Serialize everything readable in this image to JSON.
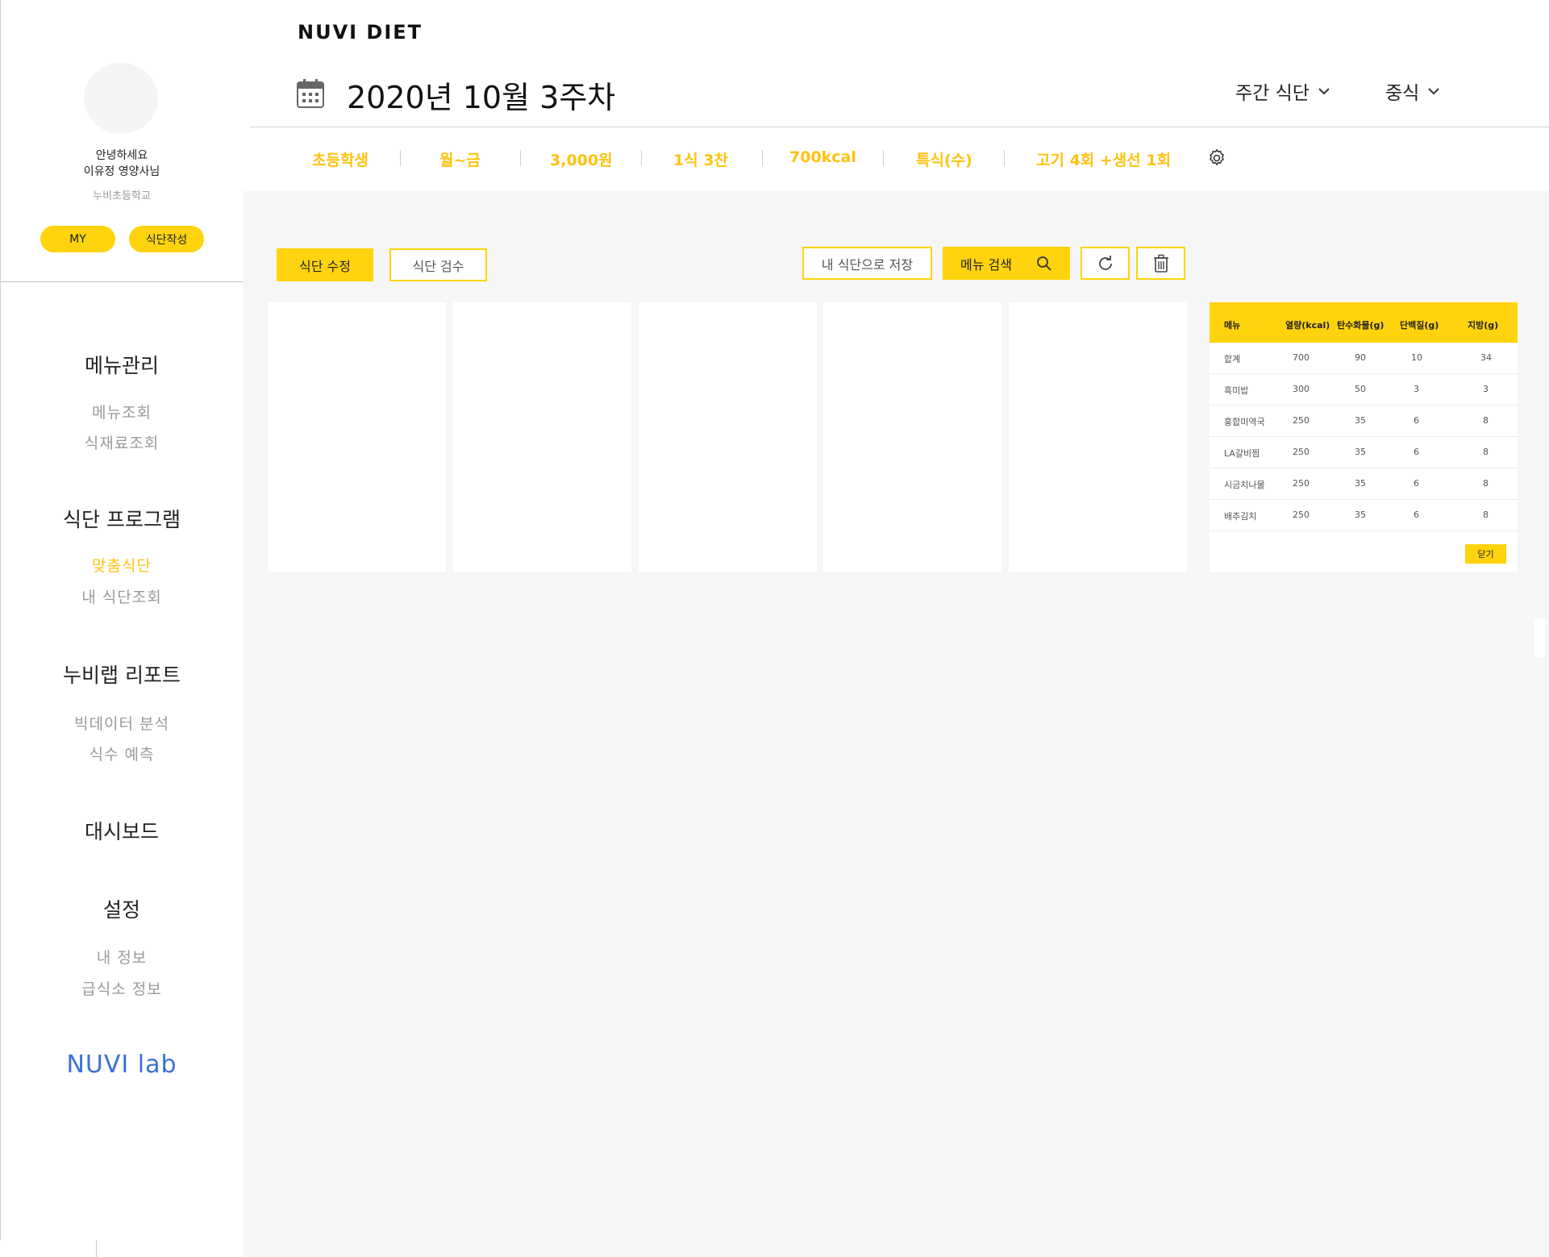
{
  "app": {
    "title": "NUVI DIET"
  },
  "profile": {
    "greeting": "안녕하세요",
    "name": "이유정 영양사님",
    "school": "누비초등학교",
    "my_label": "MY",
    "write_label": "식단작성"
  },
  "nav": {
    "sections": [
      {
        "title": "메뉴관리",
        "items": [
          "메뉴조회",
          "식재료조회"
        ]
      },
      {
        "title": "식단 프로그램",
        "items": [
          "맞춤식단",
          "내 식단조회"
        ]
      },
      {
        "title": "누비랩 리포트",
        "items": [
          "빅데이터 분석",
          "식수 예측"
        ]
      },
      {
        "title": "대시보드",
        "items": []
      },
      {
        "title": "설정",
        "items": [
          "내 정보",
          "급식소 정보"
        ]
      }
    ],
    "active_item": "맞춤식단"
  },
  "brand_logo": "NUVI lab",
  "header": {
    "week_title": "2020년 10월 3주차",
    "view_dropdown": "주간 식단",
    "meal_dropdown": "중식"
  },
  "filters": [
    "초등학생",
    "월~금",
    "3,000원",
    "1식 3찬",
    "700kcal",
    "특식(수)",
    "고기 4회 +생선 1회"
  ],
  "toolbar": {
    "edit_label": "식단 수정",
    "review_label": "식단 검수",
    "save_label": "내 식단으로 저장",
    "search_label": "메뉴 검색"
  },
  "nutrition": {
    "headers": [
      "메뉴",
      "열량(kcal)",
      "탄수화물(g)",
      "단백질(g)",
      "지방(g)"
    ],
    "rows": [
      [
        "합계",
        "700",
        "90",
        "10",
        "34"
      ],
      [
        "흑미밥",
        "300",
        "50",
        "3",
        "3"
      ],
      [
        "홍합미역국",
        "250",
        "35",
        "6",
        "8"
      ],
      [
        "LA갈비찜",
        "250",
        "35",
        "6",
        "8"
      ],
      [
        "시금치나물",
        "250",
        "35",
        "6",
        "8"
      ],
      [
        "배추김치",
        "250",
        "35",
        "6",
        "8"
      ]
    ],
    "close_label": "닫기"
  },
  "colors": {
    "accent": "#ffd30d",
    "accent_text": "#ffc20e",
    "logo": "#3b6fd8",
    "main_bg": "#f6f6f6"
  },
  "icons": [
    "calendar-icon",
    "chevron-down-icon",
    "gear-icon",
    "search-icon",
    "refresh-icon",
    "trash-icon"
  ]
}
